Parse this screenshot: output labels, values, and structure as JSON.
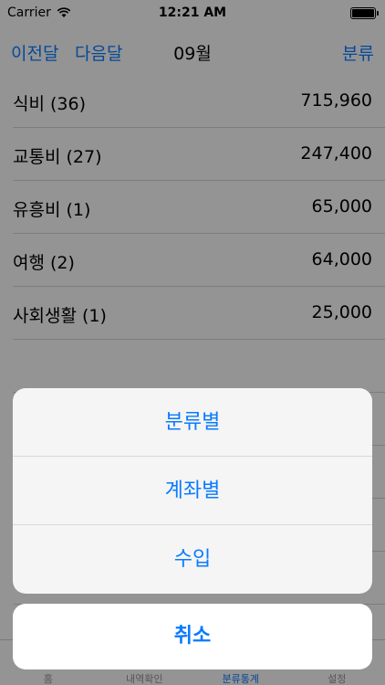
{
  "status_bar": {
    "carrier": "Carrier",
    "time": "12:21 AM"
  },
  "nav": {
    "prev": "이전달",
    "next": "다음달",
    "title": "09월",
    "category": "분류"
  },
  "rows": [
    {
      "label": "식비 (36)",
      "amount": "715,960"
    },
    {
      "label": "교통비 (27)",
      "amount": "247,400"
    },
    {
      "label": "유흥비 (1)",
      "amount": "65,000"
    },
    {
      "label": "여행 (2)",
      "amount": "64,000"
    },
    {
      "label": "사회생활 (1)",
      "amount": "25,000"
    }
  ],
  "tabs": [
    "홈",
    "내역확인",
    "분류통계",
    "설정"
  ],
  "action_sheet": {
    "options": [
      "분류별",
      "계좌별",
      "수입"
    ],
    "cancel": "취소"
  },
  "colors": {
    "accent": "#0a7aff"
  }
}
